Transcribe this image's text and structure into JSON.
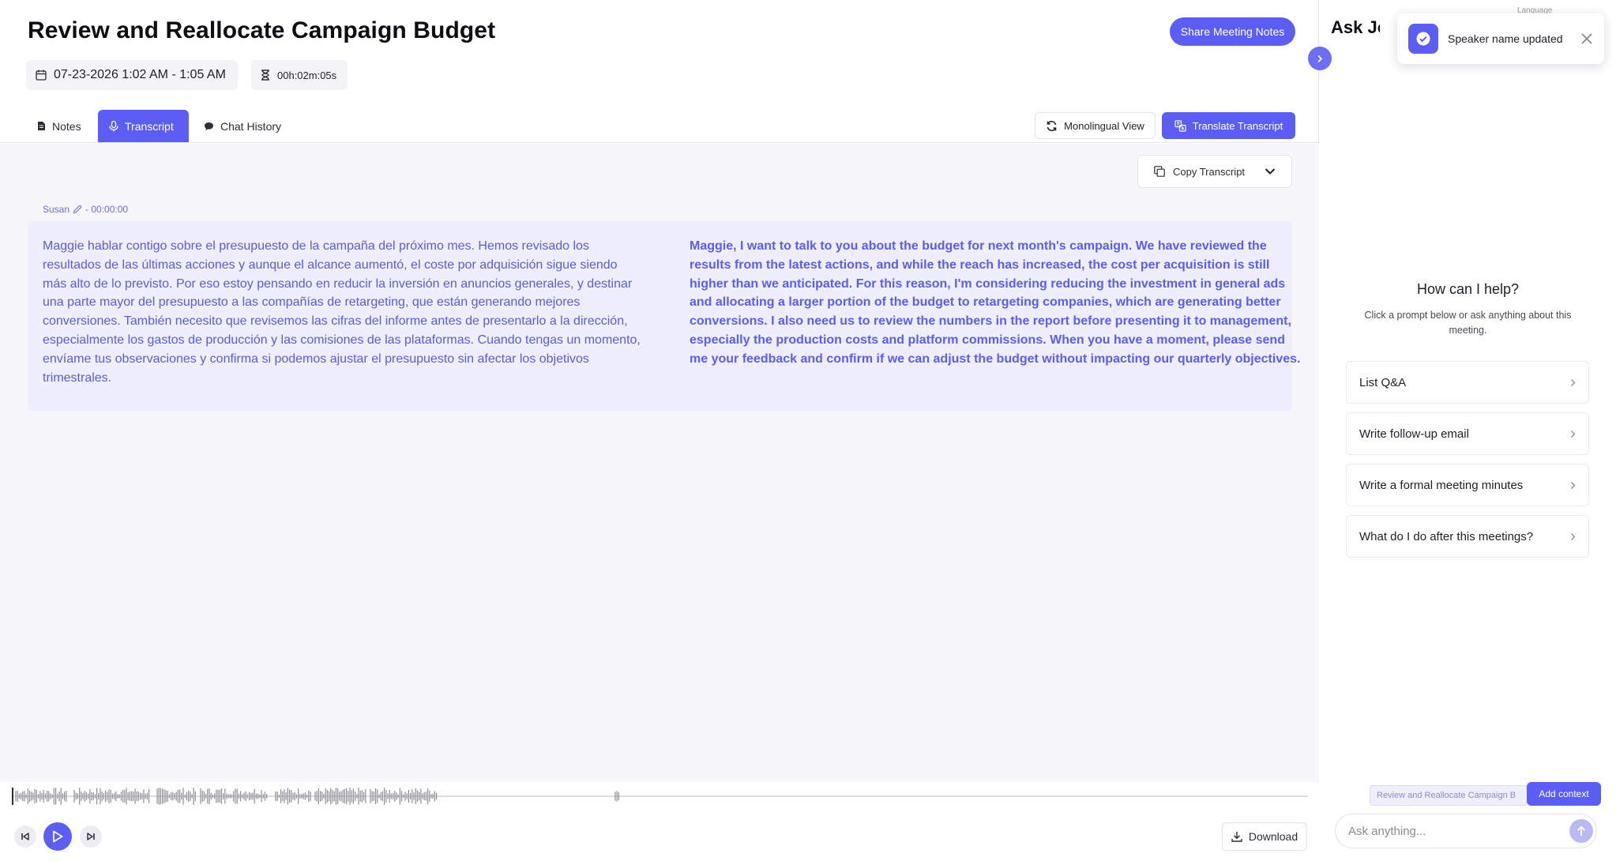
{
  "header": {
    "title": "Review and Reallocate Campaign Budget",
    "share_label": "Share Meeting Notes",
    "date_range": "07-23-2026 1:02 AM - 1:05 AM",
    "duration": "00h:02m:05s"
  },
  "tabs": [
    {
      "label": "Notes",
      "icon": "document-icon",
      "active": false
    },
    {
      "label": "Transcript",
      "icon": "microphone-icon",
      "active": true
    },
    {
      "label": "Chat History",
      "icon": "chat-bubble-icon",
      "active": false
    }
  ],
  "toolbar": {
    "mono_label": "Monolingual View",
    "translate_label": "Translate Transcript",
    "copy_label": "Copy Transcript"
  },
  "transcript": {
    "speaker": "Susan",
    "timestamp": " - 00:00:00",
    "original_text": "Maggie hablar contigo sobre el presupuesto de la campaña del próximo mes. Hemos revisado los resultados de las últimas acciones y aunque el alcance aumentó, el coste por adquisición sigue siendo más alto de lo previsto. Por eso estoy pensando en reducir la inversión en anuncios generales, y destinar una parte mayor del presupuesto a las compañías de retargeting, que están generando mejores conversiones. También necesito que revisemos las cifras del informe antes de presentarlo a la dirección, especialmente los gastos de producción y las comisiones de las plataformas. Cuando tengas un momento, envíame tus observaciones y confirma si podemos ajustar el presupuesto sin afectar los objetivos trimestrales.",
    "translated_text": "Maggie, I want to talk to you about the budget for next month's campaign. We have reviewed the results from the latest actions, and while the reach has increased, the cost per acquisition is still higher than we anticipated. For this reason, I'm considering reducing the investment in general ads and allocating a larger portion of the budget to retargeting companies, which are generating better conversions. I also need us to review the numbers in the report before presenting it to management, especially the production costs and platform commissions. When you have a moment, please send me your feedback and confirm if we can adjust the budget without impacting our quarterly objectives."
  },
  "player": {
    "download_label": "Download",
    "progress": 0.0
  },
  "assistant": {
    "title": "Ask Jotie",
    "language_label": "Language",
    "heading": "How can I help?",
    "subheading": "Click a prompt below or ask anything about this meeting.",
    "prompts": [
      "List Q&A",
      "Write follow-up email",
      "Write a formal meeting minutes",
      "What do I do after this meetings?"
    ],
    "context_chip": "Review and Reallocate Campaign B",
    "add_context_label": "Add context",
    "input_placeholder": "Ask anything..."
  },
  "toast": {
    "message": "Speaker name updated"
  },
  "colors": {
    "accent": "#5b5ef5",
    "transcript_bg": "#eeeefc",
    "page_bg": "#f7f7fb"
  }
}
